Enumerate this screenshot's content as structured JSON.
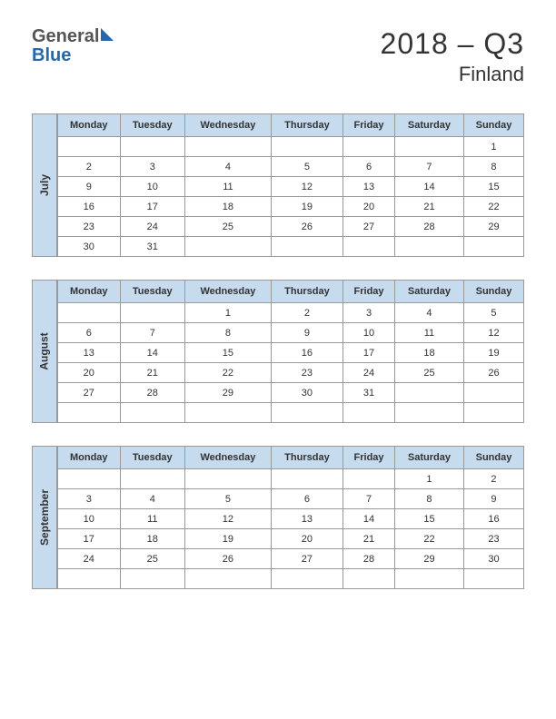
{
  "logo": {
    "part1": "General",
    "part2": "Blue"
  },
  "title": "2018 – Q3",
  "subtitle": "Finland",
  "days": [
    "Monday",
    "Tuesday",
    "Wednesday",
    "Thursday",
    "Friday",
    "Saturday",
    "Sunday"
  ],
  "months": [
    {
      "name": "July",
      "weeks": [
        [
          "",
          "",
          "",
          "",
          "",
          "",
          "1"
        ],
        [
          "2",
          "3",
          "4",
          "5",
          "6",
          "7",
          "8"
        ],
        [
          "9",
          "10",
          "11",
          "12",
          "13",
          "14",
          "15"
        ],
        [
          "16",
          "17",
          "18",
          "19",
          "20",
          "21",
          "22"
        ],
        [
          "23",
          "24",
          "25",
          "26",
          "27",
          "28",
          "29"
        ],
        [
          "30",
          "31",
          "",
          "",
          "",
          "",
          ""
        ]
      ]
    },
    {
      "name": "August",
      "weeks": [
        [
          "",
          "",
          "1",
          "2",
          "3",
          "4",
          "5"
        ],
        [
          "6",
          "7",
          "8",
          "9",
          "10",
          "11",
          "12"
        ],
        [
          "13",
          "14",
          "15",
          "16",
          "17",
          "18",
          "19"
        ],
        [
          "20",
          "21",
          "22",
          "23",
          "24",
          "25",
          "26"
        ],
        [
          "27",
          "28",
          "29",
          "30",
          "31",
          "",
          ""
        ],
        [
          "",
          "",
          "",
          "",
          "",
          "",
          ""
        ]
      ]
    },
    {
      "name": "September",
      "weeks": [
        [
          "",
          "",
          "",
          "",
          "",
          "1",
          "2"
        ],
        [
          "3",
          "4",
          "5",
          "6",
          "7",
          "8",
          "9"
        ],
        [
          "10",
          "11",
          "12",
          "13",
          "14",
          "15",
          "16"
        ],
        [
          "17",
          "18",
          "19",
          "20",
          "21",
          "22",
          "23"
        ],
        [
          "24",
          "25",
          "26",
          "27",
          "28",
          "29",
          "30"
        ],
        [
          "",
          "",
          "",
          "",
          "",
          "",
          ""
        ]
      ]
    }
  ]
}
